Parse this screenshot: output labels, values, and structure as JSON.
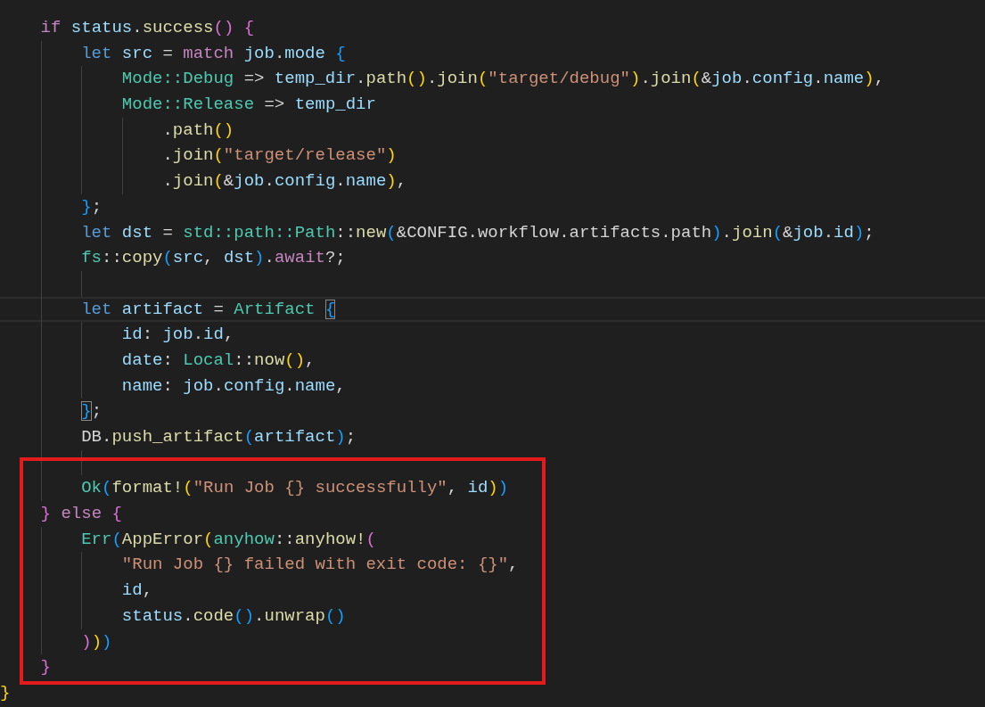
{
  "editor": {
    "lines": [
      {
        "current": false,
        "annotated": false,
        "tokens": [
          {
            "text": "    if ",
            "kind": "ctl"
          },
          {
            "text": "status",
            "kind": "var"
          },
          {
            "text": ".",
            "kind": "p"
          },
          {
            "text": "success",
            "kind": "fn"
          },
          {
            "text": "() ",
            "kind": "b2"
          },
          {
            "text": "{",
            "kind": "b2"
          }
        ]
      },
      {
        "current": false,
        "annotated": false,
        "tokens": [
          {
            "text": "        let ",
            "kind": "kw"
          },
          {
            "text": "src",
            "kind": "var"
          },
          {
            "text": " = ",
            "kind": "p"
          },
          {
            "text": "match ",
            "kind": "ctl"
          },
          {
            "text": "job",
            "kind": "var"
          },
          {
            "text": ".",
            "kind": "p"
          },
          {
            "text": "mode ",
            "kind": "var"
          },
          {
            "text": "{",
            "kind": "b3"
          }
        ]
      },
      {
        "current": false,
        "annotated": false,
        "tokens": [
          {
            "text": "            Mode::Debug",
            "kind": "ty"
          },
          {
            "text": " => ",
            "kind": "p"
          },
          {
            "text": "temp_dir",
            "kind": "var"
          },
          {
            "text": ".",
            "kind": "p"
          },
          {
            "text": "path",
            "kind": "fn"
          },
          {
            "text": "()",
            "kind": "b1"
          },
          {
            "text": ".",
            "kind": "p"
          },
          {
            "text": "join",
            "kind": "fn"
          },
          {
            "text": "(",
            "kind": "b1"
          },
          {
            "text": "\"target/debug\"",
            "kind": "str"
          },
          {
            "text": ")",
            "kind": "b1"
          },
          {
            "text": ".",
            "kind": "p"
          },
          {
            "text": "join",
            "kind": "fn"
          },
          {
            "text": "(",
            "kind": "b1"
          },
          {
            "text": "&",
            "kind": "p"
          },
          {
            "text": "job",
            "kind": "var"
          },
          {
            "text": ".",
            "kind": "p"
          },
          {
            "text": "config",
            "kind": "var"
          },
          {
            "text": ".",
            "kind": "p"
          },
          {
            "text": "name",
            "kind": "var"
          },
          {
            "text": ")",
            "kind": "b1"
          },
          {
            "text": ",",
            "kind": "p"
          }
        ]
      },
      {
        "current": false,
        "annotated": false,
        "tokens": [
          {
            "text": "            Mode::Release",
            "kind": "ty"
          },
          {
            "text": " => ",
            "kind": "p"
          },
          {
            "text": "temp_dir",
            "kind": "var"
          }
        ]
      },
      {
        "current": false,
        "annotated": false,
        "tokens": [
          {
            "text": "                .",
            "kind": "p"
          },
          {
            "text": "path",
            "kind": "fn"
          },
          {
            "text": "()",
            "kind": "b1"
          }
        ]
      },
      {
        "current": false,
        "annotated": false,
        "tokens": [
          {
            "text": "                .",
            "kind": "p"
          },
          {
            "text": "join",
            "kind": "fn"
          },
          {
            "text": "(",
            "kind": "b1"
          },
          {
            "text": "\"target/release\"",
            "kind": "str"
          },
          {
            "text": ")",
            "kind": "b1"
          }
        ]
      },
      {
        "current": false,
        "annotated": false,
        "tokens": [
          {
            "text": "                .",
            "kind": "p"
          },
          {
            "text": "join",
            "kind": "fn"
          },
          {
            "text": "(",
            "kind": "b1"
          },
          {
            "text": "&",
            "kind": "p"
          },
          {
            "text": "job",
            "kind": "var"
          },
          {
            "text": ".",
            "kind": "p"
          },
          {
            "text": "config",
            "kind": "var"
          },
          {
            "text": ".",
            "kind": "p"
          },
          {
            "text": "name",
            "kind": "var"
          },
          {
            "text": ")",
            "kind": "b1"
          },
          {
            "text": ",",
            "kind": "p"
          }
        ]
      },
      {
        "current": false,
        "annotated": false,
        "tokens": [
          {
            "text": "        }",
            "kind": "b3"
          },
          {
            "text": ";",
            "kind": "p"
          }
        ]
      },
      {
        "current": false,
        "annotated": false,
        "tokens": [
          {
            "text": "        let ",
            "kind": "kw"
          },
          {
            "text": "dst",
            "kind": "var"
          },
          {
            "text": " = ",
            "kind": "p"
          },
          {
            "text": "std::path::Path",
            "kind": "ty"
          },
          {
            "text": "::",
            "kind": "p"
          },
          {
            "text": "new",
            "kind": "fn"
          },
          {
            "text": "(",
            "kind": "b3"
          },
          {
            "text": "&CONFIG.workflow.artifacts.path",
            "kind": "p"
          },
          {
            "text": ")",
            "kind": "b3"
          },
          {
            "text": ".",
            "kind": "p"
          },
          {
            "text": "join",
            "kind": "fn"
          },
          {
            "text": "(",
            "kind": "b3"
          },
          {
            "text": "&",
            "kind": "p"
          },
          {
            "text": "job",
            "kind": "var"
          },
          {
            "text": ".",
            "kind": "p"
          },
          {
            "text": "id",
            "kind": "var"
          },
          {
            "text": ")",
            "kind": "b3"
          },
          {
            "text": ";",
            "kind": "p"
          }
        ]
      },
      {
        "current": false,
        "annotated": false,
        "tokens": [
          {
            "text": "        fs",
            "kind": "ty"
          },
          {
            "text": "::",
            "kind": "p"
          },
          {
            "text": "copy",
            "kind": "fn"
          },
          {
            "text": "(",
            "kind": "b3"
          },
          {
            "text": "src",
            "kind": "var"
          },
          {
            "text": ", ",
            "kind": "p"
          },
          {
            "text": "dst",
            "kind": "var"
          },
          {
            "text": ")",
            "kind": "b3"
          },
          {
            "text": ".",
            "kind": "p"
          },
          {
            "text": "await",
            "kind": "ctl"
          },
          {
            "text": "?;",
            "kind": "p"
          }
        ]
      },
      {
        "current": false,
        "annotated": false
      },
      {
        "current": true,
        "annotated": false,
        "tokens": [
          {
            "text": "        let ",
            "kind": "kw"
          },
          {
            "text": "artifact",
            "kind": "var"
          },
          {
            "text": " = ",
            "kind": "p"
          },
          {
            "text": "Artifact ",
            "kind": "ty"
          },
          {
            "text": "{",
            "kind": "b3m"
          }
        ]
      },
      {
        "current": false,
        "annotated": false,
        "tokens": [
          {
            "text": "            id",
            "kind": "var"
          },
          {
            "text": ": ",
            "kind": "p"
          },
          {
            "text": "job",
            "kind": "var"
          },
          {
            "text": ".",
            "kind": "p"
          },
          {
            "text": "id",
            "kind": "var"
          },
          {
            "text": ",",
            "kind": "p"
          }
        ]
      },
      {
        "current": false,
        "annotated": false,
        "tokens": [
          {
            "text": "            date",
            "kind": "var"
          },
          {
            "text": ": ",
            "kind": "p"
          },
          {
            "text": "Local",
            "kind": "ty"
          },
          {
            "text": "::",
            "kind": "p"
          },
          {
            "text": "now",
            "kind": "fn"
          },
          {
            "text": "()",
            "kind": "b1"
          },
          {
            "text": ",",
            "kind": "p"
          }
        ]
      },
      {
        "current": false,
        "annotated": false,
        "tokens": [
          {
            "text": "            name",
            "kind": "var"
          },
          {
            "text": ": ",
            "kind": "p"
          },
          {
            "text": "job",
            "kind": "var"
          },
          {
            "text": ".",
            "kind": "p"
          },
          {
            "text": "config",
            "kind": "var"
          },
          {
            "text": ".",
            "kind": "p"
          },
          {
            "text": "name",
            "kind": "var"
          },
          {
            "text": ",",
            "kind": "p"
          }
        ]
      },
      {
        "current": false,
        "annotated": false,
        "tokens": [
          {
            "text": "        }",
            "kind": "b3m"
          },
          {
            "text": ";",
            "kind": "p"
          }
        ]
      },
      {
        "current": false,
        "annotated": false,
        "tokens": [
          {
            "text": "        DB.",
            "kind": "p"
          },
          {
            "text": "push_artifact",
            "kind": "fn"
          },
          {
            "text": "(",
            "kind": "b3"
          },
          {
            "text": "artifact",
            "kind": "var"
          },
          {
            "text": ")",
            "kind": "b3"
          },
          {
            "text": ";",
            "kind": "p"
          }
        ]
      },
      {
        "current": false,
        "annotated": true
      },
      {
        "current": false,
        "annotated": true,
        "tokens": [
          {
            "text": "        Ok",
            "kind": "ty"
          },
          {
            "text": "(",
            "kind": "b3"
          },
          {
            "text": "format!",
            "kind": "fn"
          },
          {
            "text": "(",
            "kind": "b1"
          },
          {
            "text": "\"Run Job {} successfully\"",
            "kind": "str"
          },
          {
            "text": ", ",
            "kind": "p"
          },
          {
            "text": "id",
            "kind": "var"
          },
          {
            "text": ")",
            "kind": "b1"
          },
          {
            "text": ")",
            "kind": "b3"
          }
        ]
      },
      {
        "current": false,
        "annotated": true,
        "tokens": [
          {
            "text": "    } ",
            "kind": "b2"
          },
          {
            "text": "else ",
            "kind": "ctl"
          },
          {
            "text": "{",
            "kind": "b2"
          }
        ]
      },
      {
        "current": false,
        "annotated": true,
        "tokens": [
          {
            "text": "        Err",
            "kind": "ty"
          },
          {
            "text": "(",
            "kind": "b3"
          },
          {
            "text": "AppError",
            "kind": "fn"
          },
          {
            "text": "(",
            "kind": "b1"
          },
          {
            "text": "anyhow",
            "kind": "ty"
          },
          {
            "text": "::",
            "kind": "p"
          },
          {
            "text": "anyhow!",
            "kind": "fn"
          },
          {
            "text": "(",
            "kind": "b2"
          }
        ]
      },
      {
        "current": false,
        "annotated": true,
        "tokens": [
          {
            "text": "            \"Run Job {} failed with exit code: {}\"",
            "kind": "str"
          },
          {
            "text": ",",
            "kind": "p"
          }
        ]
      },
      {
        "current": false,
        "annotated": true,
        "tokens": [
          {
            "text": "            id",
            "kind": "var"
          },
          {
            "text": ",",
            "kind": "p"
          }
        ]
      },
      {
        "current": false,
        "annotated": true,
        "tokens": [
          {
            "text": "            status",
            "kind": "var"
          },
          {
            "text": ".",
            "kind": "p"
          },
          {
            "text": "code",
            "kind": "fn"
          },
          {
            "text": "()",
            "kind": "b3"
          },
          {
            "text": ".",
            "kind": "p"
          },
          {
            "text": "unwrap",
            "kind": "fn"
          },
          {
            "text": "()",
            "kind": "b3"
          }
        ]
      },
      {
        "current": false,
        "annotated": true,
        "tokens": [
          {
            "text": "        )",
            "kind": "b2"
          },
          {
            "text": ")",
            "kind": "b1"
          },
          {
            "text": ")",
            "kind": "b3"
          }
        ]
      },
      {
        "current": false,
        "annotated": true,
        "tokens": [
          {
            "text": "    }",
            "kind": "b2"
          }
        ]
      },
      {
        "current": false,
        "annotated": false,
        "tokens": [
          {
            "text": "}",
            "kind": "b1"
          }
        ]
      }
    ]
  }
}
